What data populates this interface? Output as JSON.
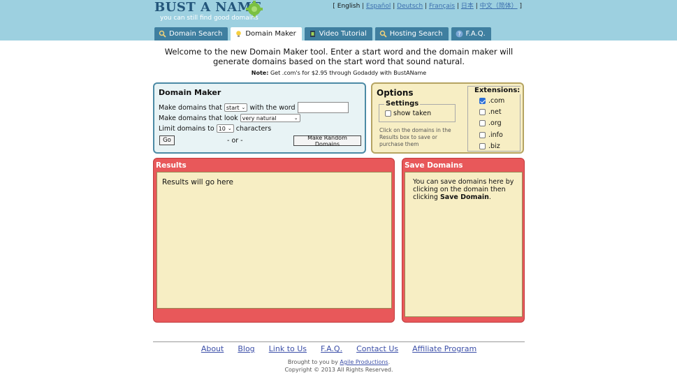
{
  "logo": {
    "name": "BUST A NAME",
    "tagline": "you can still find good domains"
  },
  "languages": [
    "English",
    "Español",
    "Deutsch",
    "Français",
    "日本",
    "中文（简体）"
  ],
  "tabs": [
    {
      "label": "Domain Search",
      "icon": "magnifier-icon",
      "active": false
    },
    {
      "label": "Domain Maker",
      "icon": "lightbulb-icon",
      "active": true
    },
    {
      "label": "Video Tutorial",
      "icon": "film-icon",
      "active": false
    },
    {
      "label": "Hosting Search",
      "icon": "magnifier-icon",
      "active": false
    },
    {
      "label": "F.A.Q.",
      "icon": "help-icon",
      "active": false
    }
  ],
  "intro": "Welcome to the new Domain Maker tool. Enter a start word and the domain maker will generate domains based on the start word that sound natural.",
  "note": {
    "label": "Note:",
    "text": " Get .com's for $2.95 through Godaddy with BustAName"
  },
  "maker": {
    "title": "Domain Maker",
    "row1_prefix": "Make domains that",
    "position_select": "start",
    "row1_suffix": "with the word",
    "word_value": "",
    "row2_prefix": "Make domains that look",
    "look_select": "very natural",
    "row3_prefix": "Limit domains to",
    "limit_select": "10",
    "row3_suffix": "characters",
    "go_label": "Go",
    "or_label": "- or -",
    "random_label": "Make Random Domains"
  },
  "options": {
    "title": "Options",
    "settings_legend": "Settings",
    "show_taken_label": "show taken",
    "show_taken_checked": false,
    "help": "Click on the domains in the Results box to save or purchase them",
    "extensions_legend": "Extensions:",
    "extensions": [
      {
        "label": ".com",
        "checked": true
      },
      {
        "label": ".net",
        "checked": false
      },
      {
        "label": ".org",
        "checked": false
      },
      {
        "label": ".info",
        "checked": false
      },
      {
        "label": ".biz",
        "checked": false
      }
    ]
  },
  "results": {
    "title": "Results",
    "placeholder": "Results will go here"
  },
  "save": {
    "title": "Save Domains",
    "text_prefix": "You can save domains here by clicking on the domain then clicking ",
    "text_bold": "Save Domain",
    "text_suffix": "."
  },
  "footer": {
    "links": [
      "About",
      "Blog",
      "Link to Us",
      "F.A.Q.",
      "Contact Us",
      "Affiliate Program"
    ],
    "credit_prefix": "Brought to you by ",
    "credit_link": "Agile Productions",
    "credit_suffix": ".",
    "copyright": "Copyright © 2013 All Rights Reserved."
  },
  "colors": {
    "header": "#9dd0e0",
    "tab": "#3f7fa0",
    "maker_bg": "#e8f3f5",
    "options_bg": "#f7eec4",
    "panel": "#e8585a"
  }
}
